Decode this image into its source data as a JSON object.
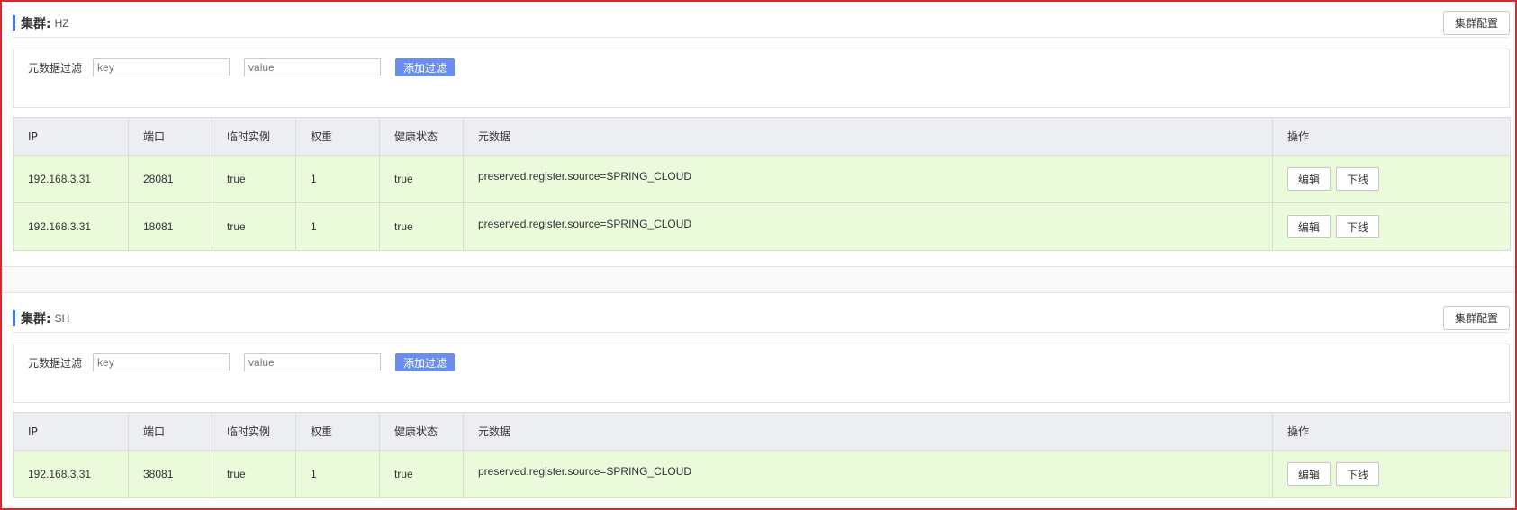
{
  "clusters": [
    {
      "title_label": "集群:",
      "name": "HZ",
      "config_button": "集群配置",
      "filter": {
        "label": "元数据过滤",
        "key_placeholder": "key",
        "value_placeholder": "value",
        "add_button": "添加过滤"
      },
      "columns": [
        "IP",
        "端口",
        "临时实例",
        "权重",
        "健康状态",
        "元数据",
        "操作"
      ],
      "rows": [
        {
          "ip": "192.168.3.31",
          "port": "28081",
          "ephemeral": "true",
          "weight": "1",
          "healthy": "true",
          "metadata": "preserved.register.source=SPRING_CLOUD"
        },
        {
          "ip": "192.168.3.31",
          "port": "18081",
          "ephemeral": "true",
          "weight": "1",
          "healthy": "true",
          "metadata": "preserved.register.source=SPRING_CLOUD"
        }
      ]
    },
    {
      "title_label": "集群:",
      "name": "SH",
      "config_button": "集群配置",
      "filter": {
        "label": "元数据过滤",
        "key_placeholder": "key",
        "value_placeholder": "value",
        "add_button": "添加过滤"
      },
      "columns": [
        "IP",
        "端口",
        "临时实例",
        "权重",
        "健康状态",
        "元数据",
        "操作"
      ],
      "rows": [
        {
          "ip": "192.168.3.31",
          "port": "38081",
          "ephemeral": "true",
          "weight": "1",
          "healthy": "true",
          "metadata": "preserved.register.source=SPRING_CLOUD"
        }
      ]
    }
  ],
  "actions": {
    "edit": "编辑",
    "offline": "下线"
  },
  "colors": {
    "accent": "#3a7be0",
    "add_button": "#6a8ef0",
    "row_bg": "#ebfadb",
    "header_bg": "#eceef2",
    "frame_border": "#d9272e"
  }
}
